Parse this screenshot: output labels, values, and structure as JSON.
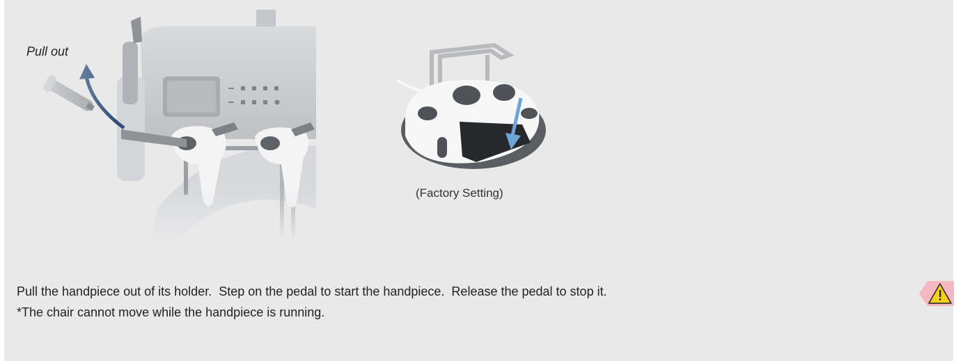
{
  "illustration_unit": {
    "label": "Pull out"
  },
  "illustration_pedal": {
    "caption": "(Factory Setting)"
  },
  "instructions": {
    "line1": "Pull the handpiece out of its holder.  Step on the pedal to start the handpiece.  Release the pedal to stop it.",
    "line2": "*The chair cannot move while the handpiece is running."
  },
  "warning": {
    "icon": "warning-triangle-icon",
    "background_color": "#f5b8c0",
    "icon_color": "#f2d01c"
  },
  "colors": {
    "panel_background": "#e9e9ea",
    "arrow_dark": "#2f4f79",
    "arrow_light": "#6ea4da"
  }
}
